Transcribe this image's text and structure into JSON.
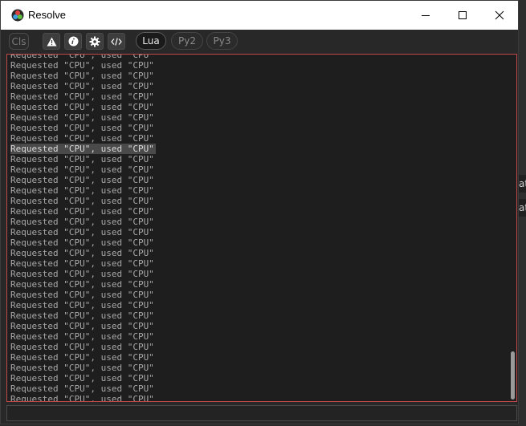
{
  "window": {
    "title": "Resolve"
  },
  "toolbar": {
    "cls_label": "Cls",
    "langs": [
      {
        "label": "Lua",
        "active": true
      },
      {
        "label": "Py2",
        "active": false
      },
      {
        "label": "Py3",
        "active": false
      }
    ]
  },
  "background": {
    "frag1": "at",
    "frag2": "at"
  },
  "console": {
    "lines": [
      "Requested \"CPU\", used \"CPU\"",
      "Requested \"CPU\", used \"CPU\"",
      "Requested \"CPU\", used \"CPU\"",
      "Requested \"CPU\", used \"CPU\"",
      "Requested \"CPU\", used \"CPU\"",
      "Requested \"CPU\", used \"CPU\"",
      "Requested \"CPU\", used \"CPU\"",
      "Requested \"CPU\", used \"CPU\"",
      "Requested \"CPU\", used \"CPU\"",
      "Requested \"CPU\", used \"CPU\"",
      "Requested \"CPU\", used \"CPU\"",
      "Requested \"CPU\", used \"CPU\"",
      "Requested \"CPU\", used \"CPU\"",
      "Requested \"CPU\", used \"CPU\"",
      "Requested \"CPU\", used \"CPU\"",
      "Requested \"CPU\", used \"CPU\"",
      "Requested \"CPU\", used \"CPU\"",
      "Requested \"CPU\", used \"CPU\"",
      "Requested \"CPU\", used \"CPU\"",
      "Requested \"CPU\", used \"CPU\"",
      "Requested \"CPU\", used \"CPU\"",
      "Requested \"CPU\", used \"CPU\"",
      "Requested \"CPU\", used \"CPU\"",
      "Requested \"CPU\", used \"CPU\"",
      "Requested \"CPU\", used \"CPU\"",
      "Requested \"CPU\", used \"CPU\"",
      "Requested \"CPU\", used \"CPU\"",
      "Requested \"CPU\", used \"CPU\"",
      "Requested \"CPU\", used \"CPU\"",
      "Requested \"CPU\", used \"CPU\"",
      "Requested \"CPU\", used \"CPU\"",
      "Requested \"CPU\", used \"CPU\"",
      "Requested \"CPU\", used \"CPU\"",
      "Requested \"CPU\", used \"CPU\""
    ],
    "selected_index": 9
  },
  "input": {
    "value": ""
  },
  "colors": {
    "border_accent": "#c04a4a",
    "text": "#a8a8a8"
  }
}
